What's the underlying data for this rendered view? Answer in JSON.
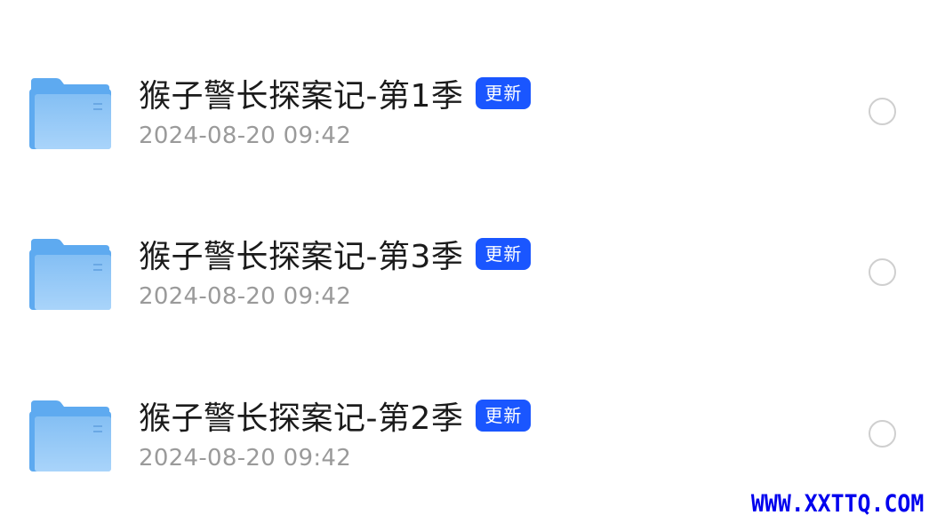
{
  "files": [
    {
      "name": "猴子警长探案记-第1季",
      "badge": "更新",
      "date": "2024-08-20 09:42",
      "icon": "folder-icon"
    },
    {
      "name": "猴子警长探案记-第3季",
      "badge": "更新",
      "date": "2024-08-20 09:42",
      "icon": "folder-icon"
    },
    {
      "name": "猴子警长探案记-第2季",
      "badge": "更新",
      "date": "2024-08-20 09:42",
      "icon": "folder-icon"
    }
  ],
  "watermark": "WWW.XXTTQ.COM",
  "colors": {
    "badge_bg": "#1a56ff",
    "folder_front": "#8ec6f6",
    "folder_back": "#5eaaf0",
    "date_text": "#9a9a9a",
    "radio_border": "#cfcfcf",
    "watermark": "#0000ee"
  }
}
